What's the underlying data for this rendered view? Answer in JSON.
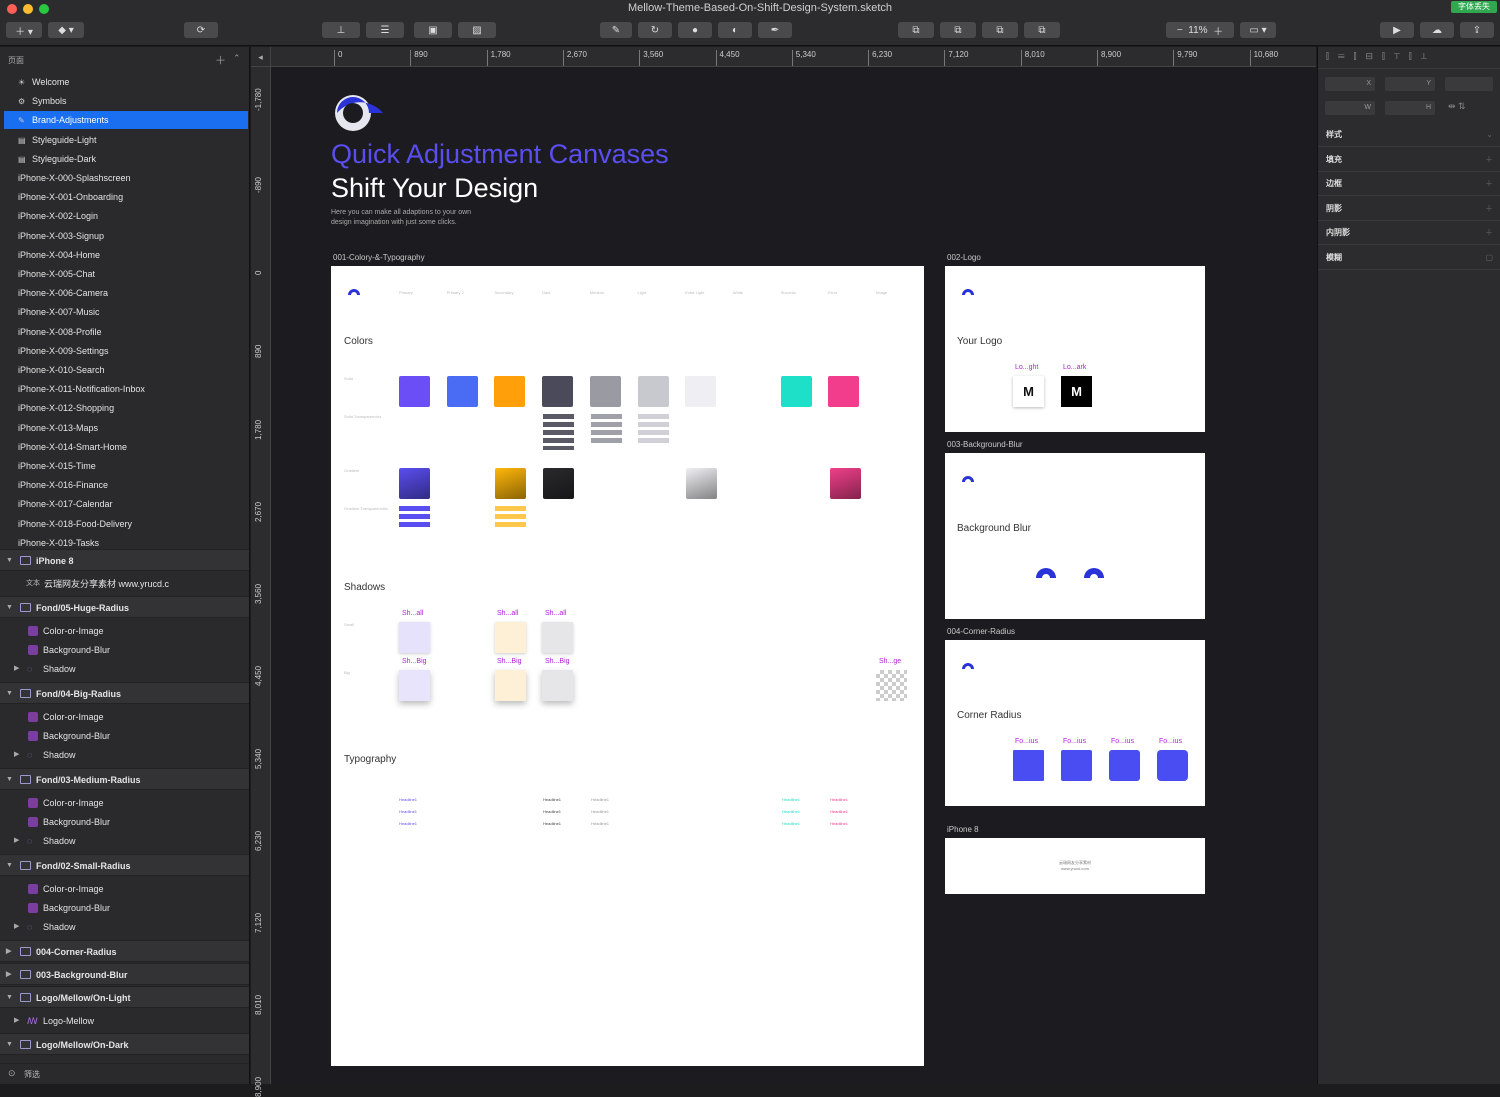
{
  "window": {
    "title": "Mellow-Theme-Based-On-Shift-Design-System.sketch",
    "badge": "字体丢失",
    "zoom": "11%"
  },
  "sidebar": {
    "pages_header": "页面",
    "pages": [
      {
        "label": "Welcome",
        "icon": "sun-icon"
      },
      {
        "label": "Symbols",
        "icon": "symbol-icon"
      },
      {
        "label": "Brand-Adjustments",
        "icon": "pencil-icon",
        "selected": true
      },
      {
        "label": "Styleguide-Light",
        "icon": "page-icon"
      },
      {
        "label": "Styleguide-Dark",
        "icon": "page-icon"
      },
      {
        "label": "iPhone-X-000-Splashscreen"
      },
      {
        "label": "iPhone-X-001-Onboarding"
      },
      {
        "label": "iPhone-X-002-Login"
      },
      {
        "label": "iPhone-X-003-Signup"
      },
      {
        "label": "iPhone-X-004-Home"
      },
      {
        "label": "iPhone-X-005-Chat"
      },
      {
        "label": "iPhone-X-006-Camera"
      },
      {
        "label": "iPhone-X-007-Music"
      },
      {
        "label": "iPhone-X-008-Profile"
      },
      {
        "label": "iPhone-X-009-Settings"
      },
      {
        "label": "iPhone-X-010-Search"
      },
      {
        "label": "iPhone-X-011-Notification-Inbox"
      },
      {
        "label": "iPhone-X-012-Shopping"
      },
      {
        "label": "iPhone-X-013-Maps"
      },
      {
        "label": "iPhone-X-014-Smart-Home"
      },
      {
        "label": "iPhone-X-015-Time"
      },
      {
        "label": "iPhone-X-016-Finance"
      },
      {
        "label": "iPhone-X-017-Calendar"
      },
      {
        "label": "iPhone-X-018-Food-Delivery"
      },
      {
        "label": "iPhone-X-019-Tasks"
      }
    ],
    "layers": [
      {
        "label": "iPhone 8",
        "kind": "group"
      },
      {
        "label": "云瑞网友分享素材 www.yrucd.c",
        "kind": "text",
        "prefix": "文本"
      },
      {
        "label": "Fond/05-Huge-Radius",
        "kind": "group"
      },
      {
        "label": "Color-or-Image",
        "kind": "item"
      },
      {
        "label": "Background-Blur",
        "kind": "item"
      },
      {
        "label": "Shadow",
        "kind": "symbol"
      },
      {
        "label": "Fond/04-Big-Radius",
        "kind": "group"
      },
      {
        "label": "Color-or-Image",
        "kind": "item"
      },
      {
        "label": "Background-Blur",
        "kind": "item"
      },
      {
        "label": "Shadow",
        "kind": "symbol"
      },
      {
        "label": "Fond/03-Medium-Radius",
        "kind": "group"
      },
      {
        "label": "Color-or-Image",
        "kind": "item"
      },
      {
        "label": "Background-Blur",
        "kind": "item"
      },
      {
        "label": "Shadow",
        "kind": "symbol"
      },
      {
        "label": "Fond/02-Small-Radius",
        "kind": "group"
      },
      {
        "label": "Color-or-Image",
        "kind": "item"
      },
      {
        "label": "Background-Blur",
        "kind": "item"
      },
      {
        "label": "Shadow",
        "kind": "symbol"
      },
      {
        "label": "004-Corner-Radius",
        "kind": "group2"
      },
      {
        "label": "003-Background-Blur",
        "kind": "group2"
      },
      {
        "label": "Logo/Mellow/On-Light",
        "kind": "group"
      },
      {
        "label": "Logo-Mellow",
        "kind": "symbol2"
      },
      {
        "label": "Logo/Mellow/On-Dark",
        "kind": "group"
      }
    ],
    "filter_label": "筛选"
  },
  "ruler": {
    "h": [
      "0",
      "890",
      "1,780",
      "2,670",
      "3,560",
      "4,450",
      "5,340",
      "6,230",
      "7,120",
      "8,010",
      "8,900",
      "9,790",
      "10,680"
    ],
    "v": [
      "-1,780",
      "-890",
      "0",
      "890",
      "1,780",
      "2,670",
      "3,560",
      "4,450",
      "5,340",
      "6,230",
      "7,120",
      "8,010",
      "8,900"
    ]
  },
  "inspector": {
    "fields": [
      "X",
      "Y",
      "W",
      "H"
    ],
    "sections": [
      "样式",
      "填充",
      "边框",
      "阴影",
      "内阴影",
      "模糊"
    ]
  },
  "canvas": {
    "heading": "Quick Adjustment Canvases",
    "subheading": "Shift Your Design",
    "intro_line1": "Here you can make all adaptions to your own",
    "intro_line2": "design imagination with just some clicks.",
    "artboards": {
      "a1": "001-Colory-&-Typography",
      "a2": "002-Logo",
      "a3": "003-Background-Blur",
      "a4": "004-Corner-Radius",
      "a5": "iPhone 8"
    },
    "colors": {
      "title": "Colors",
      "headers": [
        "Primary",
        "Primary 2",
        "Secondary",
        "Dark",
        "Medium",
        "Light",
        "Extra Light",
        "White",
        "Success",
        "Error",
        "Image"
      ],
      "solid": [
        "#6b4ef6",
        "#4a6cf5",
        "#ff9f0a",
        "#4a4a5a",
        "#9a9aa2",
        "#c8c8cf",
        "#eeeef3",
        "#ffffff",
        "#1ee0c8",
        "#f23c8c"
      ],
      "gradient": [
        "#5a4ef0",
        "#ffb70a",
        "#2a2a2c",
        "#f0f0f4",
        "#f0408a"
      ]
    },
    "shadows": {
      "title": "Shadows",
      "small": [
        "Sh...all",
        "Sh...all",
        "Sh...all"
      ],
      "big": [
        "Sh...Big",
        "Sh...Big",
        "Sh...Big"
      ],
      "image": "Sh...ge"
    },
    "typography": {
      "title": "Typography",
      "sample": "Headline1"
    },
    "logo": {
      "title": "Your Logo",
      "on_light": "Lo...ght",
      "on_dark": "Lo...ark"
    },
    "blur": {
      "title": "Background Blur"
    },
    "radius": {
      "title": "Corner Radius",
      "labels": [
        "Fo...ius",
        "Fo...ius",
        "Fo...ius",
        "Fo...ius"
      ]
    },
    "iphone8_line1": "云瑞网友分享素材",
    "iphone8_line2": "www.yrucd.com"
  },
  "colors": {
    "accent": "#1a6ff0",
    "brand": "#3b3bf0"
  }
}
